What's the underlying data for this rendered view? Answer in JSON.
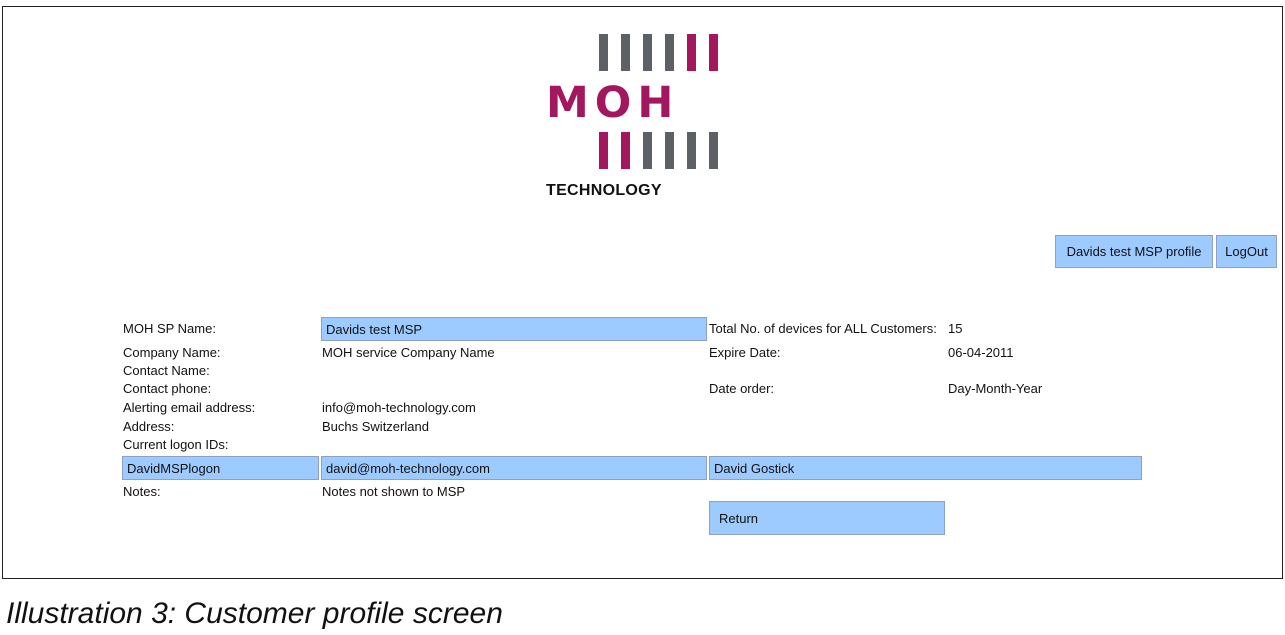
{
  "logo": {
    "word": "MOH",
    "subtitle": "TECHNOLOGY",
    "colors": {
      "magenta": "#a3175f",
      "gray": "#5d6166"
    }
  },
  "header": {
    "profile_button": "Davids test MSP profile",
    "logout_button": "LogOut"
  },
  "form": {
    "sp_name_label": "MOH SP Name:",
    "sp_name_value": "Davids test MSP",
    "total_devices_label": "Total No. of devices for ALL Customers:",
    "total_devices_value": "15",
    "company_name_label": "Company Name:",
    "company_name_value": "MOH service Company Name",
    "expire_date_label": "Expire Date:",
    "expire_date_value": "06-04-2011",
    "contact_name_label": "Contact Name:",
    "contact_phone_label": "Contact phone:",
    "date_order_label": "Date order:",
    "date_order_value": "Day-Month-Year",
    "alert_email_label": "Alerting email address:",
    "alert_email_value": "info@moh-technology.com",
    "address_label": "Address:",
    "address_value": "Buchs Switzerland",
    "logon_ids_label": "Current logon IDs:",
    "logon": {
      "id": "DavidMSPlogon",
      "email": "david@moh-technology.com",
      "name": "David Gostick"
    },
    "notes_label": "Notes:",
    "notes_value": "Notes not shown to MSP",
    "return_button": "Return"
  },
  "caption": "Illustration 3: Customer profile screen"
}
